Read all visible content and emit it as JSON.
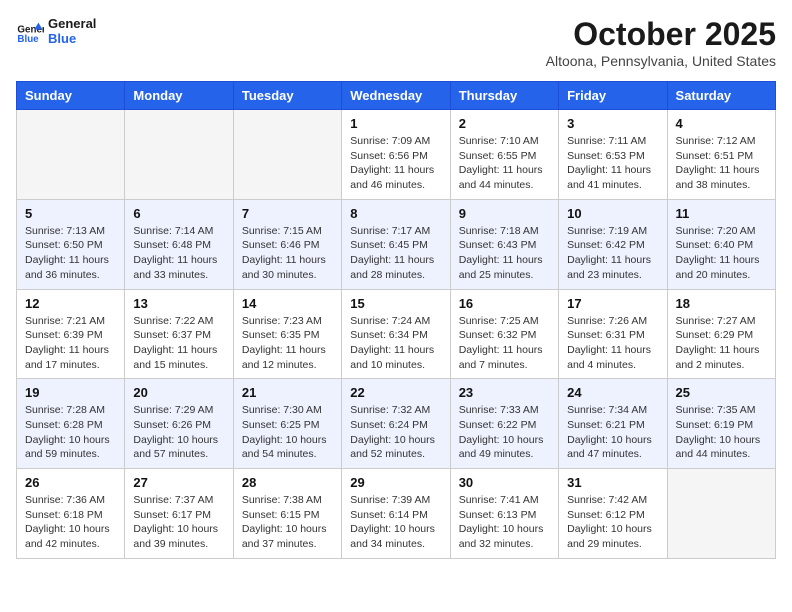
{
  "logo": {
    "text_general": "General",
    "text_blue": "Blue"
  },
  "header": {
    "month": "October 2025",
    "location": "Altoona, Pennsylvania, United States"
  },
  "days_of_week": [
    "Sunday",
    "Monday",
    "Tuesday",
    "Wednesday",
    "Thursday",
    "Friday",
    "Saturday"
  ],
  "weeks": [
    {
      "alt": false,
      "days": [
        {
          "num": "",
          "info": ""
        },
        {
          "num": "",
          "info": ""
        },
        {
          "num": "",
          "info": ""
        },
        {
          "num": "1",
          "info": "Sunrise: 7:09 AM\nSunset: 6:56 PM\nDaylight: 11 hours\nand 46 minutes."
        },
        {
          "num": "2",
          "info": "Sunrise: 7:10 AM\nSunset: 6:55 PM\nDaylight: 11 hours\nand 44 minutes."
        },
        {
          "num": "3",
          "info": "Sunrise: 7:11 AM\nSunset: 6:53 PM\nDaylight: 11 hours\nand 41 minutes."
        },
        {
          "num": "4",
          "info": "Sunrise: 7:12 AM\nSunset: 6:51 PM\nDaylight: 11 hours\nand 38 minutes."
        }
      ]
    },
    {
      "alt": true,
      "days": [
        {
          "num": "5",
          "info": "Sunrise: 7:13 AM\nSunset: 6:50 PM\nDaylight: 11 hours\nand 36 minutes."
        },
        {
          "num": "6",
          "info": "Sunrise: 7:14 AM\nSunset: 6:48 PM\nDaylight: 11 hours\nand 33 minutes."
        },
        {
          "num": "7",
          "info": "Sunrise: 7:15 AM\nSunset: 6:46 PM\nDaylight: 11 hours\nand 30 minutes."
        },
        {
          "num": "8",
          "info": "Sunrise: 7:17 AM\nSunset: 6:45 PM\nDaylight: 11 hours\nand 28 minutes."
        },
        {
          "num": "9",
          "info": "Sunrise: 7:18 AM\nSunset: 6:43 PM\nDaylight: 11 hours\nand 25 minutes."
        },
        {
          "num": "10",
          "info": "Sunrise: 7:19 AM\nSunset: 6:42 PM\nDaylight: 11 hours\nand 23 minutes."
        },
        {
          "num": "11",
          "info": "Sunrise: 7:20 AM\nSunset: 6:40 PM\nDaylight: 11 hours\nand 20 minutes."
        }
      ]
    },
    {
      "alt": false,
      "days": [
        {
          "num": "12",
          "info": "Sunrise: 7:21 AM\nSunset: 6:39 PM\nDaylight: 11 hours\nand 17 minutes."
        },
        {
          "num": "13",
          "info": "Sunrise: 7:22 AM\nSunset: 6:37 PM\nDaylight: 11 hours\nand 15 minutes."
        },
        {
          "num": "14",
          "info": "Sunrise: 7:23 AM\nSunset: 6:35 PM\nDaylight: 11 hours\nand 12 minutes."
        },
        {
          "num": "15",
          "info": "Sunrise: 7:24 AM\nSunset: 6:34 PM\nDaylight: 11 hours\nand 10 minutes."
        },
        {
          "num": "16",
          "info": "Sunrise: 7:25 AM\nSunset: 6:32 PM\nDaylight: 11 hours\nand 7 minutes."
        },
        {
          "num": "17",
          "info": "Sunrise: 7:26 AM\nSunset: 6:31 PM\nDaylight: 11 hours\nand 4 minutes."
        },
        {
          "num": "18",
          "info": "Sunrise: 7:27 AM\nSunset: 6:29 PM\nDaylight: 11 hours\nand 2 minutes."
        }
      ]
    },
    {
      "alt": true,
      "days": [
        {
          "num": "19",
          "info": "Sunrise: 7:28 AM\nSunset: 6:28 PM\nDaylight: 10 hours\nand 59 minutes."
        },
        {
          "num": "20",
          "info": "Sunrise: 7:29 AM\nSunset: 6:26 PM\nDaylight: 10 hours\nand 57 minutes."
        },
        {
          "num": "21",
          "info": "Sunrise: 7:30 AM\nSunset: 6:25 PM\nDaylight: 10 hours\nand 54 minutes."
        },
        {
          "num": "22",
          "info": "Sunrise: 7:32 AM\nSunset: 6:24 PM\nDaylight: 10 hours\nand 52 minutes."
        },
        {
          "num": "23",
          "info": "Sunrise: 7:33 AM\nSunset: 6:22 PM\nDaylight: 10 hours\nand 49 minutes."
        },
        {
          "num": "24",
          "info": "Sunrise: 7:34 AM\nSunset: 6:21 PM\nDaylight: 10 hours\nand 47 minutes."
        },
        {
          "num": "25",
          "info": "Sunrise: 7:35 AM\nSunset: 6:19 PM\nDaylight: 10 hours\nand 44 minutes."
        }
      ]
    },
    {
      "alt": false,
      "days": [
        {
          "num": "26",
          "info": "Sunrise: 7:36 AM\nSunset: 6:18 PM\nDaylight: 10 hours\nand 42 minutes."
        },
        {
          "num": "27",
          "info": "Sunrise: 7:37 AM\nSunset: 6:17 PM\nDaylight: 10 hours\nand 39 minutes."
        },
        {
          "num": "28",
          "info": "Sunrise: 7:38 AM\nSunset: 6:15 PM\nDaylight: 10 hours\nand 37 minutes."
        },
        {
          "num": "29",
          "info": "Sunrise: 7:39 AM\nSunset: 6:14 PM\nDaylight: 10 hours\nand 34 minutes."
        },
        {
          "num": "30",
          "info": "Sunrise: 7:41 AM\nSunset: 6:13 PM\nDaylight: 10 hours\nand 32 minutes."
        },
        {
          "num": "31",
          "info": "Sunrise: 7:42 AM\nSunset: 6:12 PM\nDaylight: 10 hours\nand 29 minutes."
        },
        {
          "num": "",
          "info": ""
        }
      ]
    }
  ]
}
